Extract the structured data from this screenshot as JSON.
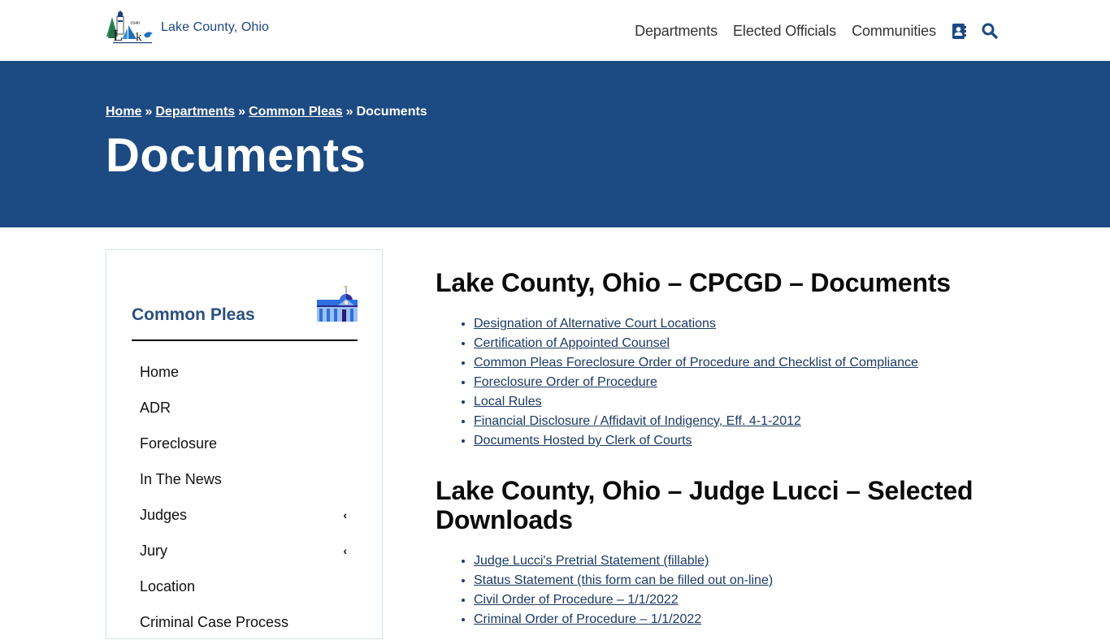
{
  "header": {
    "site_name": "Lake County, Ohio",
    "logo_year": "1840",
    "logo_word": "Lake",
    "nav": [
      {
        "label": "Departments"
      },
      {
        "label": "Elected Officials"
      },
      {
        "label": "Communities"
      }
    ],
    "icons": {
      "directory": "contact-book-icon",
      "search": "search-icon"
    }
  },
  "hero": {
    "breadcrumb": [
      {
        "label": "Home",
        "link": true
      },
      {
        "label": "Departments",
        "link": true
      },
      {
        "label": "Common Pleas",
        "link": true
      },
      {
        "label": "Documents",
        "link": false
      }
    ],
    "separator": "»",
    "title": "Documents"
  },
  "sidebar": {
    "title": "Common Pleas",
    "icon": "courthouse-icon",
    "items": [
      {
        "label": "Home",
        "has_children": false
      },
      {
        "label": "ADR",
        "has_children": false
      },
      {
        "label": "Foreclosure",
        "has_children": false
      },
      {
        "label": "In The News",
        "has_children": false
      },
      {
        "label": "Judges",
        "has_children": true,
        "chevron": "‹"
      },
      {
        "label": "Jury",
        "has_children": true,
        "chevron": "‹"
      },
      {
        "label": "Location",
        "has_children": false
      },
      {
        "label": "Criminal Case Process",
        "has_children": false
      }
    ]
  },
  "main": {
    "sections": [
      {
        "heading": "Lake County, Ohio – CPCGD – Documents",
        "links": [
          "Designation of Alternative Court Locations",
          "Certification of Appointed Counsel",
          "Common Pleas Foreclosure Order of Procedure and Checklist of Compliance",
          "Foreclosure Order of Procedure",
          "Local Rules",
          "Financial Disclosure / Affidavit of Indigency, Eff. 4-1-2012",
          "Documents Hosted by Clerk of Courts"
        ]
      },
      {
        "heading": "Lake County, Ohio – Judge Lucci – Selected Downloads",
        "links": [
          "Judge Lucci's Pretrial Statement (fillable)",
          "Status Statement (this form can be filled out on-line)",
          "Civil Order of Procedure – 1/1/2022",
          "Criminal Order of Procedure – 1/1/2022"
        ]
      }
    ]
  },
  "colors": {
    "brand_blue": "#1c4a82",
    "link_blue": "#1c3a63",
    "sidebar_title": "#2b4f7e",
    "sidebar_border": "#d4e1ea"
  }
}
